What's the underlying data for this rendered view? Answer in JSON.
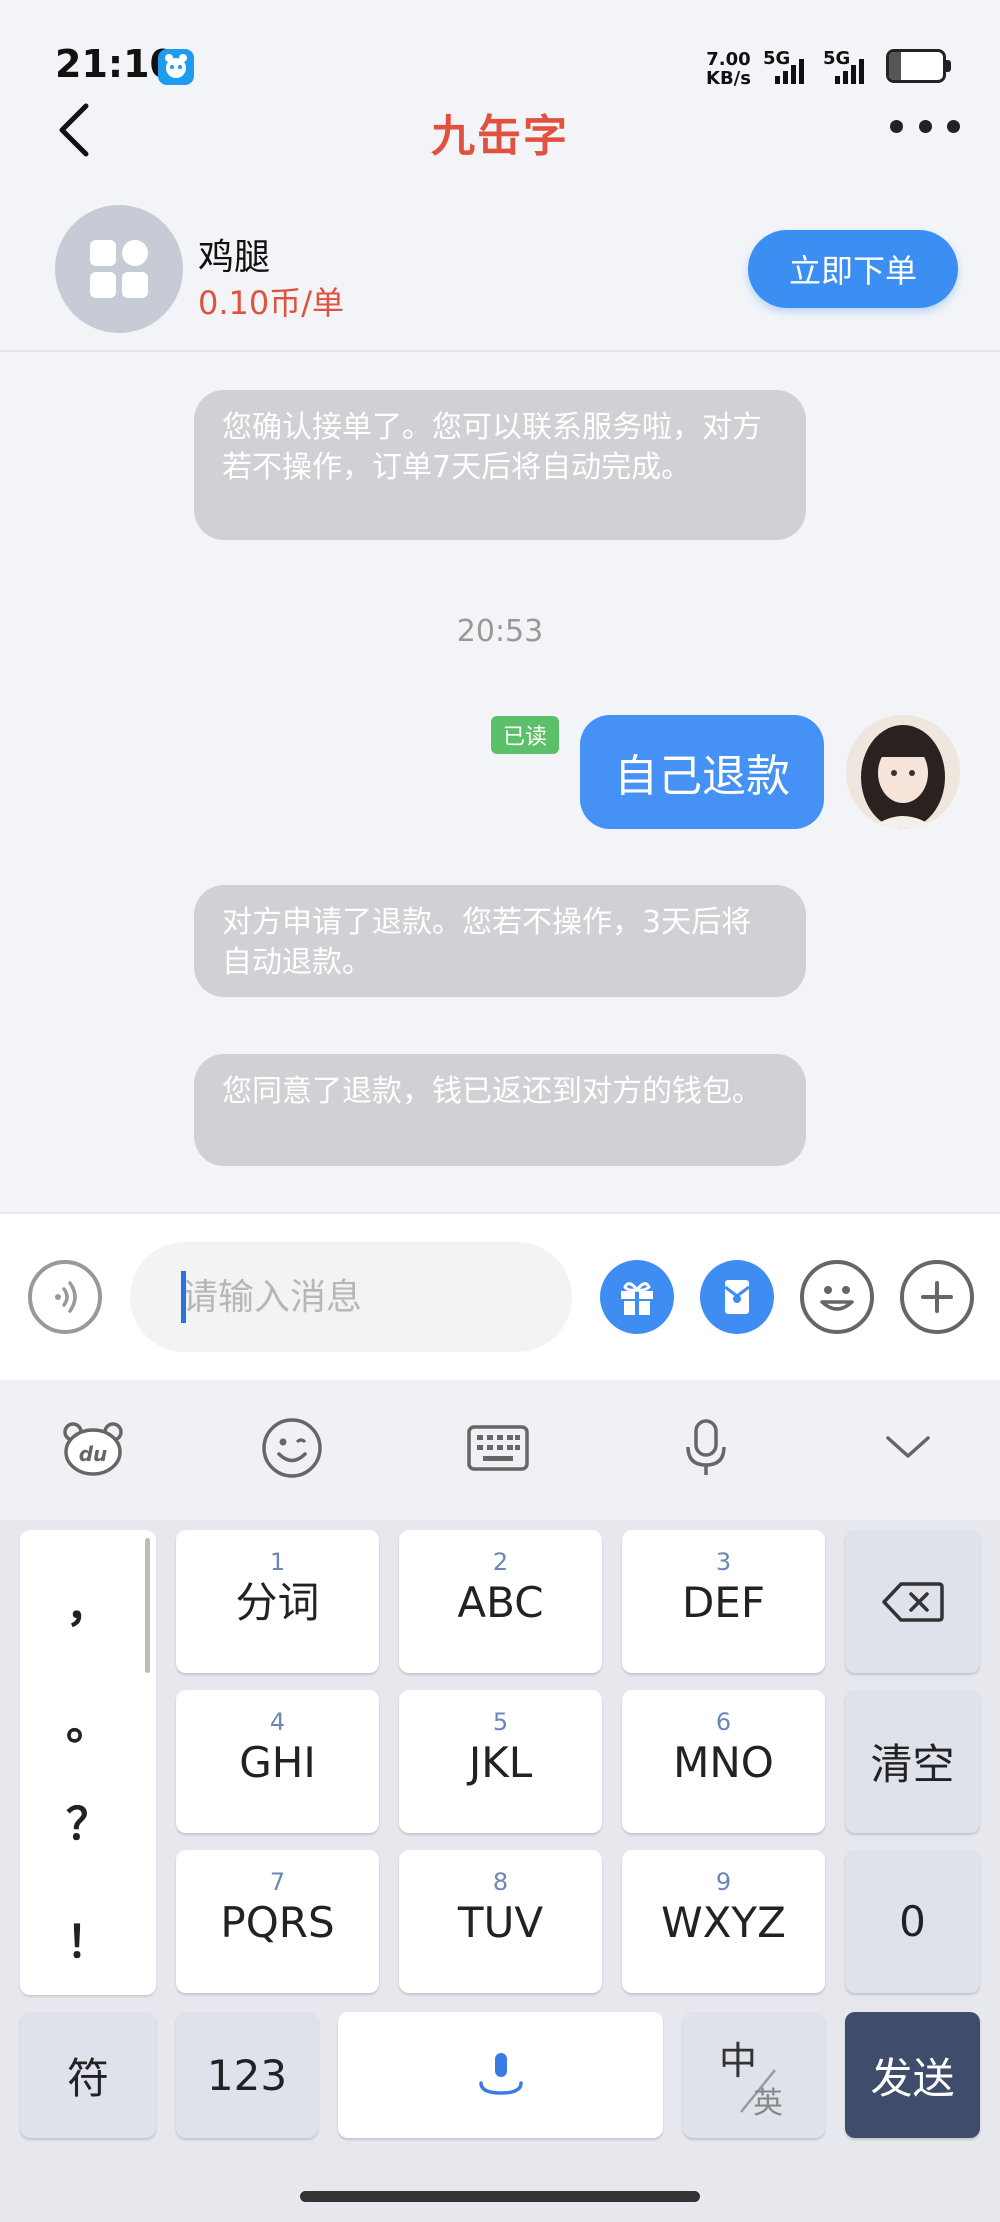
{
  "status_bar": {
    "time": "21:10",
    "net_speed_value": "7.00",
    "net_speed_unit": "KB/s",
    "sim1_label": "5G",
    "sim2_label": "5G",
    "battery_level": 23,
    "battery_text": "23"
  },
  "header": {
    "title": "九缶字",
    "back_icon": "chevron-left-icon",
    "more_icon": "more-horizontal-icon"
  },
  "product": {
    "name": "鸡腿",
    "price": "0.10币/单",
    "order_button_label": "立即下单",
    "avatar_icon": "app-grid-icon"
  },
  "chat": {
    "system_msg_1": "您确认接单了。您可以联系服务啦，对方若不操作，订单7天后将自动完成。",
    "time": "20:53",
    "read_badge": "已读",
    "my_message": "自己退款",
    "system_msg_2": "对方申请了退款。您若不操作，3天后将自动退款。",
    "system_msg_3": "您同意了退款，钱已返还到对方的钱包。"
  },
  "input_bar": {
    "placeholder": "请输入消息",
    "buttons": [
      "voice-icon",
      "gift-icon",
      "red-packet-icon",
      "emoji-icon",
      "plus-icon"
    ]
  },
  "keyboard": {
    "toolbar": [
      "du-bear-icon",
      "emoji-face-icon",
      "keyboard-icon",
      "microphone-icon",
      "chevron-down-icon"
    ],
    "punctuation": [
      "，",
      "。",
      "？",
      "！"
    ],
    "keys": [
      {
        "num": "1",
        "label": "分词"
      },
      {
        "num": "2",
        "label": "ABC"
      },
      {
        "num": "3",
        "label": "DEF"
      },
      {
        "num": "4",
        "label": "GHI"
      },
      {
        "num": "5",
        "label": "JKL"
      },
      {
        "num": "6",
        "label": "MNO"
      },
      {
        "num": "7",
        "label": "PQRS"
      },
      {
        "num": "8",
        "label": "TUV"
      },
      {
        "num": "9",
        "label": "WXYZ"
      }
    ],
    "clear_label": "清空",
    "zero_label": "0",
    "symbol_label": "符",
    "num_label": "123",
    "lang_main": "中",
    "lang_sub": "英",
    "send_label": "发送"
  },
  "colors": {
    "accent_blue": "#3c8ff2",
    "title_red": "#e2513f",
    "system_bubble": "#cfd1d5",
    "read_green": "#5cc06a",
    "send_key": "#3f4c6b"
  }
}
